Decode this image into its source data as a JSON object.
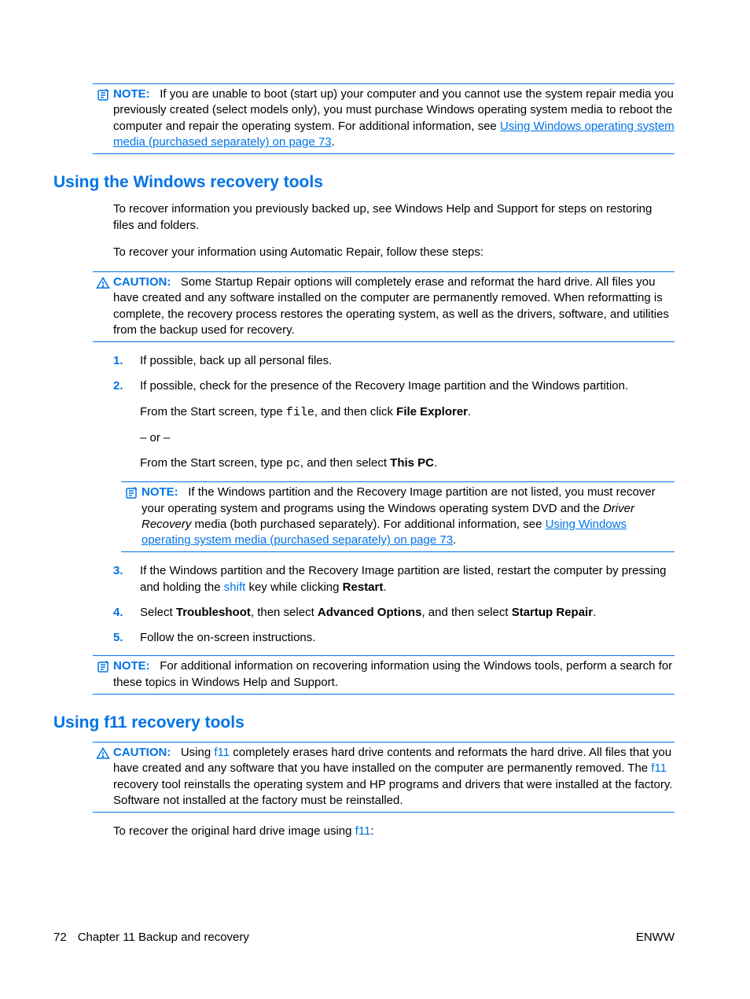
{
  "labels": {
    "note": "NOTE:",
    "caution": "CAUTION:"
  },
  "note1": {
    "t1": "If you are unable to boot (start up) your computer and you cannot use the system repair media you previously created (select models only), you must purchase Windows operating system media to reboot the computer and repair the operating system. For additional information, see ",
    "link": "Using Windows operating system media (purchased separately) on page 73",
    "t2": "."
  },
  "h1": "Using the Windows recovery tools",
  "p1": "To recover information you previously backed up, see Windows Help and Support for steps on restoring files and folders.",
  "p2": "To recover your information using Automatic Repair, follow these steps:",
  "caution1": {
    "t": "Some Startup Repair options will completely erase and reformat the hard drive. All files you have created and any software installed on the computer are permanently removed. When reformatting is complete, the recovery process restores the operating system, as well as the drivers, software, and utilities from the backup used for recovery."
  },
  "steps": [
    {
      "n": "1.",
      "t": "If possible, back up all personal files."
    },
    {
      "n": "2.",
      "t": "If possible, check for the presence of the Recovery Image partition and the Windows partition.",
      "sub1a": "From the Start screen, type ",
      "sub1code": "file",
      "sub1b": ", and then click ",
      "sub1bold": "File Explorer",
      "sub1c": ".",
      "sub2": "– or –",
      "sub3a": "From the Start screen, type ",
      "sub3code": "pc",
      "sub3b": ", and then select ",
      "sub3bold": "This PC",
      "sub3c": "."
    },
    {
      "n": "3.",
      "ta": "If the Windows partition and the Recovery Image partition are listed, restart the computer by pressing and holding the ",
      "key": "shift",
      "tb": " key while clicking ",
      "bold": "Restart",
      "tc": "."
    },
    {
      "n": "4.",
      "ta": "Select ",
      "b1": "Troubleshoot",
      "tb": ", then select ",
      "b2": "Advanced Options",
      "tc": ", and then select ",
      "b3": "Startup Repair",
      "td": "."
    },
    {
      "n": "5.",
      "t": "Follow the on-screen instructions."
    }
  ],
  "note2": {
    "t1": "If the Windows partition and the Recovery Image partition are not listed, you must recover your operating system and programs using the Windows operating system DVD and the ",
    "italic": "Driver Recovery",
    "t2": " media (both purchased separately). For additional information, see ",
    "link": "Using Windows operating system media (purchased separately) on page 73",
    "t3": "."
  },
  "note3": {
    "t": "For additional information on recovering information using the Windows tools, perform a search for these topics in Windows Help and Support."
  },
  "h2": "Using f11 recovery tools",
  "caution2": {
    "t1": "Using ",
    "key1": "f11",
    "t2": " completely erases hard drive contents and reformats the hard drive. All files that you have created and any software that you have installed on the computer are permanently removed. The ",
    "key2": "f11",
    "t3": " recovery tool reinstalls the operating system and HP programs and drivers that were installed at the factory. Software not installed at the factory must be reinstalled."
  },
  "p3a": "To recover the original hard drive image using ",
  "p3key": "f11",
  "p3b": ":",
  "footer": {
    "pagenum": "72",
    "chapter": "Chapter 11   Backup and recovery",
    "enww": "ENWW"
  }
}
